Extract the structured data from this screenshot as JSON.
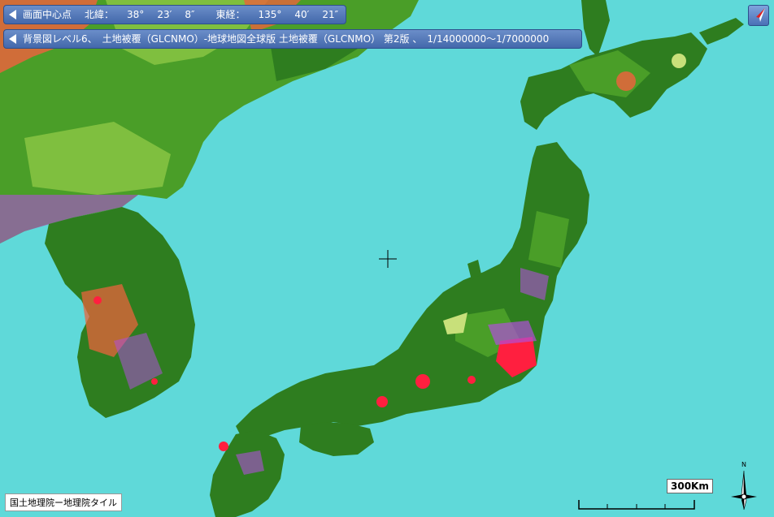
{
  "center_bar": {
    "label": "画面中心点",
    "lat_label": "北緯：",
    "lat_deg": "38°",
    "lat_min": "23′",
    "lat_sec": "8″",
    "lon_label": "東経：",
    "lon_deg": "135°",
    "lon_min": "40′",
    "lon_sec": "21″"
  },
  "layer_bar": {
    "text": "背景図レベル6、　土地被覆（GLCNMO）-地球地図全球版 土地被覆（GLCNMO） 第2版 、　1/14000000〜1/7000000"
  },
  "attribution": "国土地理院ー地理院タイル",
  "scale": {
    "label": "300Km"
  },
  "compass": {
    "north_label": "N"
  },
  "colors": {
    "sea": "#5fd9d9",
    "forest": "#2e7d1f",
    "cropland": "#7fbf3f",
    "urban": "#ff1f3f",
    "wetland": "#b04fd9",
    "shrub": "#e8643c",
    "grass": "#c8e07a",
    "panel": "#4a70b6"
  }
}
